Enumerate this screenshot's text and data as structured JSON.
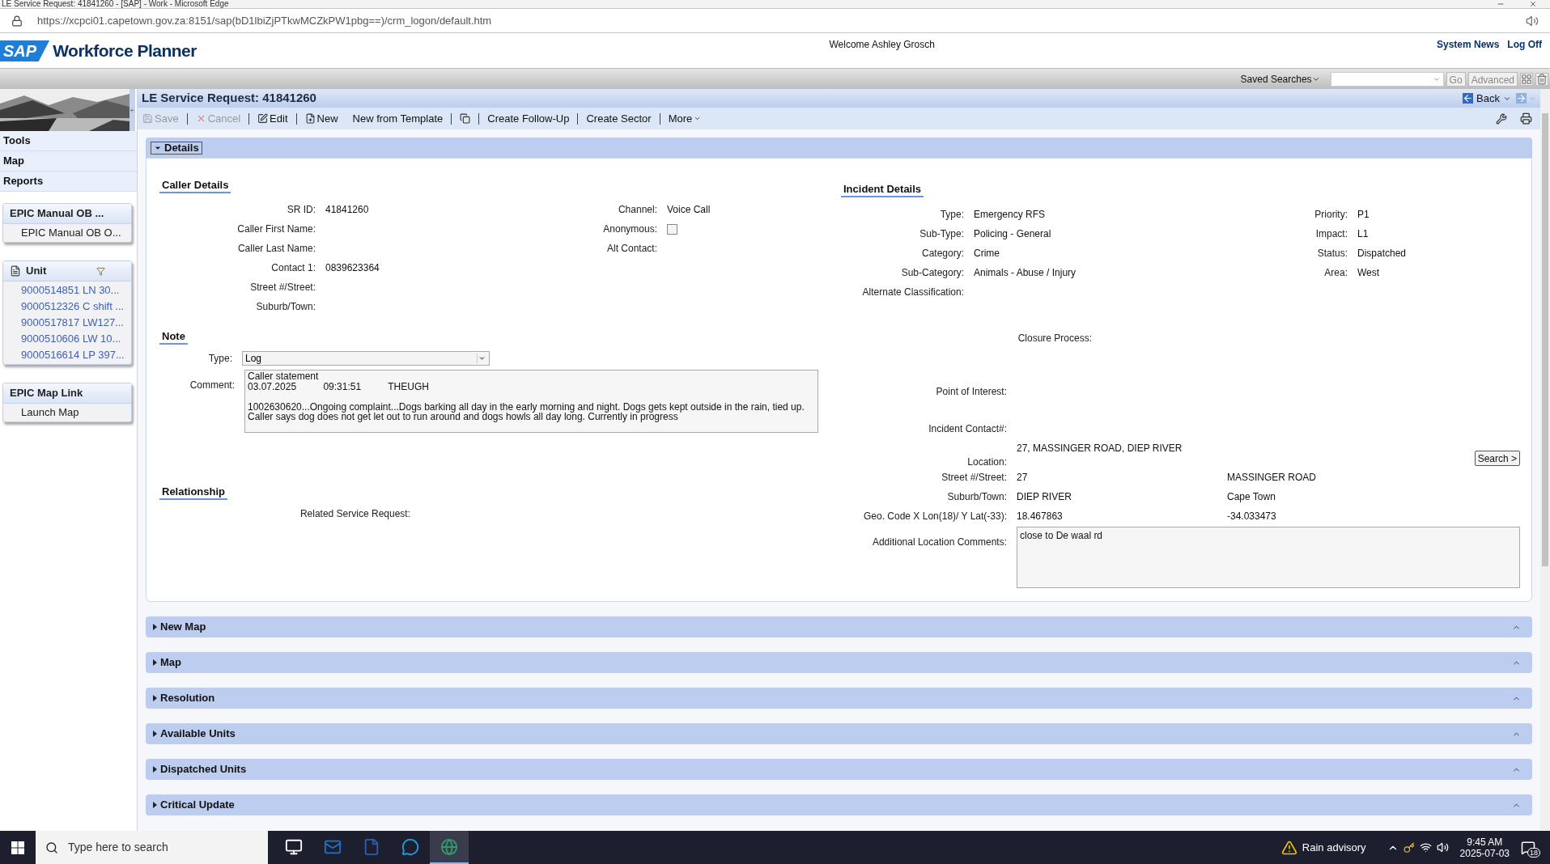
{
  "browser": {
    "title": "LE Service Request: 41841260 - [SAP] - Work - Microsoft Edge",
    "url": "https://xcpci01.capetown.gov.za:8151/sap(bD1lbiZjPTkwMCZkPW1pbg==)/crm_logon/default.htm"
  },
  "header": {
    "logo": "SAP",
    "product": "Workforce Planner",
    "welcome": "Welcome Ashley Grosch",
    "links": [
      "System News",
      "Log Off"
    ]
  },
  "search_bar": {
    "saved_searches": "Saved Searches",
    "go": "Go",
    "advanced": "Advanced"
  },
  "sidebar": {
    "nav": [
      "Tools",
      "Map",
      "Reports"
    ],
    "panels": [
      {
        "kind": "plain",
        "title": "EPIC Manual OB ...",
        "items": [
          "EPIC Manual OB O..."
        ]
      },
      {
        "kind": "unit",
        "title": "Unit",
        "items": [
          "9000514851 LN 30...",
          "9000512326 C shift ...",
          "9000517817 LW127...",
          "9000510606 LW 10...",
          "9000516614 LP 397..."
        ]
      },
      {
        "kind": "plain",
        "title": "EPIC Map Link",
        "items": [
          "Launch Map"
        ]
      }
    ]
  },
  "page": {
    "title": "LE Service Request: 41841260",
    "back": "Back"
  },
  "toolbar": [
    {
      "label": "Save",
      "disabled": true
    },
    {
      "label": "Cancel",
      "disabled": true
    },
    {
      "label": "Edit",
      "disabled": false
    },
    {
      "label": "New",
      "disabled": false
    },
    {
      "label": "New from Template",
      "disabled": false
    },
    {
      "disabled": false
    },
    {
      "label": "Create Follow-Up",
      "disabled": false
    },
    {
      "label": "Create Sector",
      "disabled": false
    },
    {
      "label": "More",
      "disabled": false
    }
  ],
  "details": {
    "title": "Details",
    "expanded": true,
    "caller": {
      "heading": "Caller Details",
      "left": [
        {
          "label": "SR ID:",
          "value": "41841260"
        },
        {
          "label": "Caller First Name:"
        },
        {
          "label": "Caller Last Name:"
        },
        {
          "label": "Contact 1:",
          "value": "0839623364"
        },
        {
          "label": "Street #/Street:"
        },
        {
          "label": "Suburb/Town:"
        }
      ],
      "right": [
        {
          "kind": "text",
          "label": "Channel:",
          "value": "Voice Call"
        },
        {
          "kind": "checkbox",
          "label": "Anonymous:",
          "checked": false
        },
        {
          "kind": "text",
          "label": "Alt Contact:"
        }
      ]
    },
    "note": {
      "heading": "Note",
      "type_label": "Type:",
      "type_value": "Log",
      "comment_label": "Comment:",
      "comment": "Caller statement\n03.07.2025          09:31:51          THEUGH\n\n1002630620...Ongoing complaint...Dogs barking all day in the early morning and night. Dogs gets kept outside in the rain, tied up. Caller says dog does not get let out to run around and dogs howls all day long. Currently in progress"
    },
    "relationship": {
      "heading": "Relationship",
      "label": "Related Service Request:"
    },
    "incident": {
      "heading": "Incident Details",
      "left": [
        {
          "label": "Type:",
          "value": "Emergency RFS"
        },
        {
          "label": "Sub-Type:",
          "value": "Policing - General"
        },
        {
          "label": "Category:",
          "value": "Crime"
        },
        {
          "label": "Sub-Category:",
          "value": "Animals - Abuse / Injury"
        },
        {
          "label": "Alternate Classification:"
        }
      ],
      "right": [
        {
          "label": "Priority:",
          "value": "P1"
        },
        {
          "label": "Impact:",
          "value": "L1"
        },
        {
          "label": "Status:",
          "value": "Dispatched"
        },
        {
          "label": "Area:",
          "value": "West"
        }
      ]
    },
    "location": {
      "closure_label": "Closure Process:",
      "poi_label": "Point of Interest:",
      "contact_label": "Incident Contact#:",
      "location_label": "Location:",
      "location_value": "27, MASSINGER ROAD, DIEP RIVER",
      "search": "Search >",
      "rows": [
        {
          "label": "Street #/Street:",
          "values": [
            "27",
            "MASSINGER ROAD"
          ]
        },
        {
          "label": "Suburb/Town:",
          "values": [
            "DIEP RIVER",
            "Cape Town"
          ]
        },
        {
          "label": "Geo. Code X Lon(18)/ Y Lat(-33):",
          "values": [
            "18.467863",
            "-34.033473"
          ]
        }
      ],
      "comments_label": "Additional Location Comments:",
      "comments": "close to De waal rd"
    }
  },
  "sections": [
    {
      "title": "New Map",
      "expanded": false
    },
    {
      "title": "Map",
      "expanded": false
    },
    {
      "title": "Resolution",
      "expanded": false
    },
    {
      "title": "Available Units",
      "expanded": false
    },
    {
      "title": "Dispatched Units",
      "expanded": false
    },
    {
      "title": "Critical Update",
      "expanded": false
    }
  ],
  "taskbar": {
    "search_placeholder": "Type here to search",
    "apps": [
      {
        "selected": false
      },
      {
        "selected": false
      },
      {
        "selected": false
      },
      {
        "selected": false
      },
      {
        "selected": true
      }
    ],
    "weather": "Rain advisory",
    "time": "9:45 AM",
    "date": "2025-07-03",
    "notifications": "18"
  }
}
